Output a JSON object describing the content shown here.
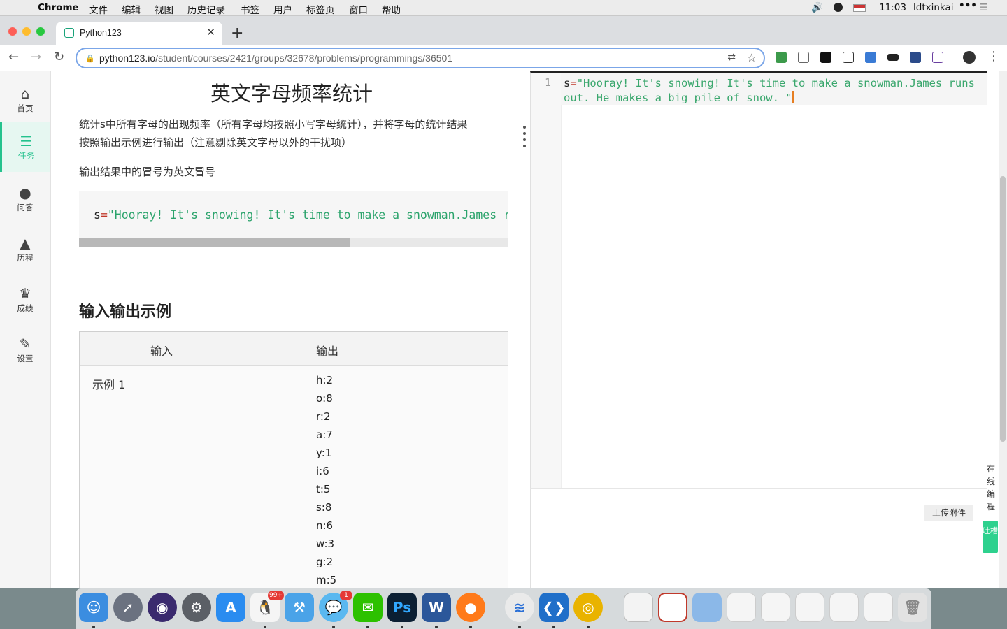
{
  "menubar": {
    "app": "Chrome",
    "items": [
      "文件",
      "编辑",
      "视图",
      "历史记录",
      "书签",
      "用户",
      "标签页",
      "窗口",
      "帮助"
    ],
    "time": "11:03",
    "user": "ldtxinkai"
  },
  "browser": {
    "tab_title": "Python123",
    "url_host": "python123.io",
    "url_path": "/student/courses/2421/groups/32678/problems/programmings/36501"
  },
  "sidebar": {
    "items": [
      {
        "label": "首页",
        "icon": "home-icon"
      },
      {
        "label": "任务",
        "icon": "tasks-icon"
      },
      {
        "label": "问答",
        "icon": "chat-icon"
      },
      {
        "label": "历程",
        "icon": "tree-icon"
      },
      {
        "label": "成绩",
        "icon": "trophy-icon"
      },
      {
        "label": "设置",
        "icon": "wrench-icon"
      }
    ]
  },
  "problem": {
    "title": "英文字母频率统计",
    "description_line1": "统计s中所有字母的出现频率（所有字母均按照小写字母统计），并将字母的统计结果",
    "description_line2": "按照输出示例进行输出（注意剔除英文字母以外的干扰项）",
    "note": "输出结果中的冒号为英文冒号",
    "code_var": "s",
    "code_op": "=",
    "code_string": "\"Hooray! It's snowing! It's time to make a snowman.James run",
    "examples_heading": "输入输出示例",
    "table_headers": {
      "input": "输入",
      "output": "输出"
    },
    "example_label": "示例 1",
    "example_output": [
      "h:2",
      "o:8",
      "r:2",
      "a:7",
      "y:1",
      "i:6",
      "t:5",
      "s:8",
      "n:6",
      "w:3",
      "g:2",
      "m:5"
    ]
  },
  "editor": {
    "line_number": "1",
    "code_var": "s",
    "code_op": "=",
    "code_string": "\"Hooray! It's snowing! It's time to make a snowman.James runs out. He makes a big pile of snow. \"",
    "upload_button": "上传附件",
    "side_vertical_text": "在线编程",
    "side_tab_text": "吐槽"
  },
  "dock": {
    "qq_badge": "99+",
    "messages_badge": "1",
    "photoshop_label": "Ps",
    "word_label": "W"
  }
}
